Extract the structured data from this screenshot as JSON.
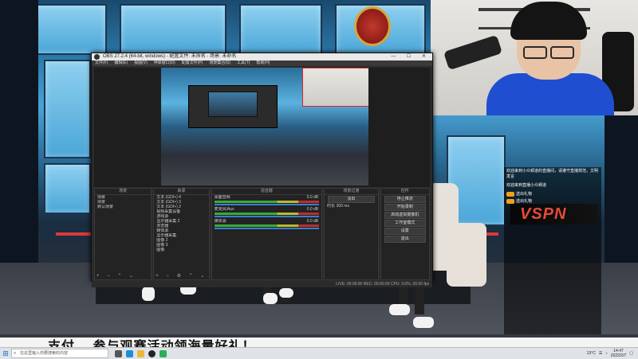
{
  "obs": {
    "title": "OBS 27.2.4 (64-bit, windows) - 配置文件: 未命名 - 场景: 未命名",
    "menu": [
      "文件(F)",
      "编辑(E)",
      "视图(V)",
      "停靠窗口(D)",
      "配置文件(P)",
      "场景集合(S)",
      "工具(T)",
      "帮助(H)"
    ],
    "dock_headers": {
      "scenes": "场景",
      "sources": "来源",
      "mixer": "混音器",
      "transitions": "场景过渡",
      "controls": "控件"
    },
    "scenes": [
      "场景",
      "场景",
      "默认场景"
    ],
    "sources": [
      "文本 (GDI+) 4",
      "文本 (GDI+) 3",
      "文本 (GDI+) 2",
      "视频采集设备",
      "游戏源",
      "显示器采集 2",
      "浏览器",
      "媒体源",
      "显示器采集",
      "图像 2",
      "图像 3",
      "图像"
    ],
    "mixer": [
      {
        "name": "桌面音频",
        "level": "0.0 dB"
      },
      {
        "name": "麦克风/Aux",
        "level": "0.0 dB"
      },
      {
        "name": "媒体源",
        "level": "0.0 dB"
      }
    ],
    "transitions": {
      "type": "淡出",
      "duration_label": "时长",
      "duration": "300 ms"
    },
    "controls": [
      "停止推流",
      "开始录制",
      "启动虚拟摄像机",
      "工作室模式",
      "设置",
      "退出"
    ],
    "status": "LIVE: 00:00:00  REC: 00:00:00  CPU: 3.0%, 30.00 fps"
  },
  "chat": {
    "messages": [
      "欢迎来到小众频道的直播间，请遵守直播规范，文明发言",
      "欢迎来到直播小众频道"
    ],
    "gifts": [
      "送出礼物",
      "送出礼物"
    ]
  },
  "overlay": {
    "brand": "VSPN"
  },
  "banner": {
    "text": "支付 ，参与观赛活动领海量好礼！"
  },
  "taskbar": {
    "search_placeholder": "在这里输入你要搜索的内容",
    "temperature": "13°C",
    "time": "14:47",
    "date": "2022/2/7"
  },
  "colors": {
    "accent_red": "#d83a3a",
    "obs_bg": "#2b2b2b",
    "webcam_shirt": "#1f4fd0"
  }
}
